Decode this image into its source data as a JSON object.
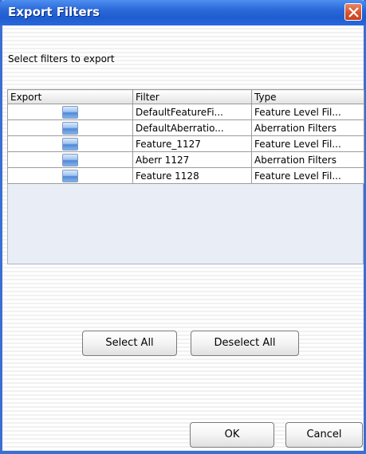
{
  "window": {
    "title": "Export Filters"
  },
  "prompt": "Select filters to export",
  "table": {
    "columns": [
      "Export",
      "Filter",
      "Type"
    ],
    "rows": [
      {
        "filter": "DefaultFeatureFi...",
        "type": "Feature Level Fil..."
      },
      {
        "filter": "DefaultAberratio...",
        "type": "Aberration Filters"
      },
      {
        "filter": "Feature_1127",
        "type": "Feature Level Fil..."
      },
      {
        "filter": "Aberr 1127",
        "type": "Aberration Filters"
      },
      {
        "filter": "Feature 1128",
        "type": "Feature Level Fil..."
      }
    ]
  },
  "buttons": {
    "select_all": "Select All",
    "deselect_all": "Deselect All",
    "ok": "OK",
    "cancel": "Cancel"
  },
  "icons": {
    "close": "close-icon",
    "checkbox": "checkbox-icon"
  },
  "colors": {
    "titlebar": "#2a67d8",
    "close_button": "#d5502a",
    "checkbox": "#4f88d6"
  }
}
